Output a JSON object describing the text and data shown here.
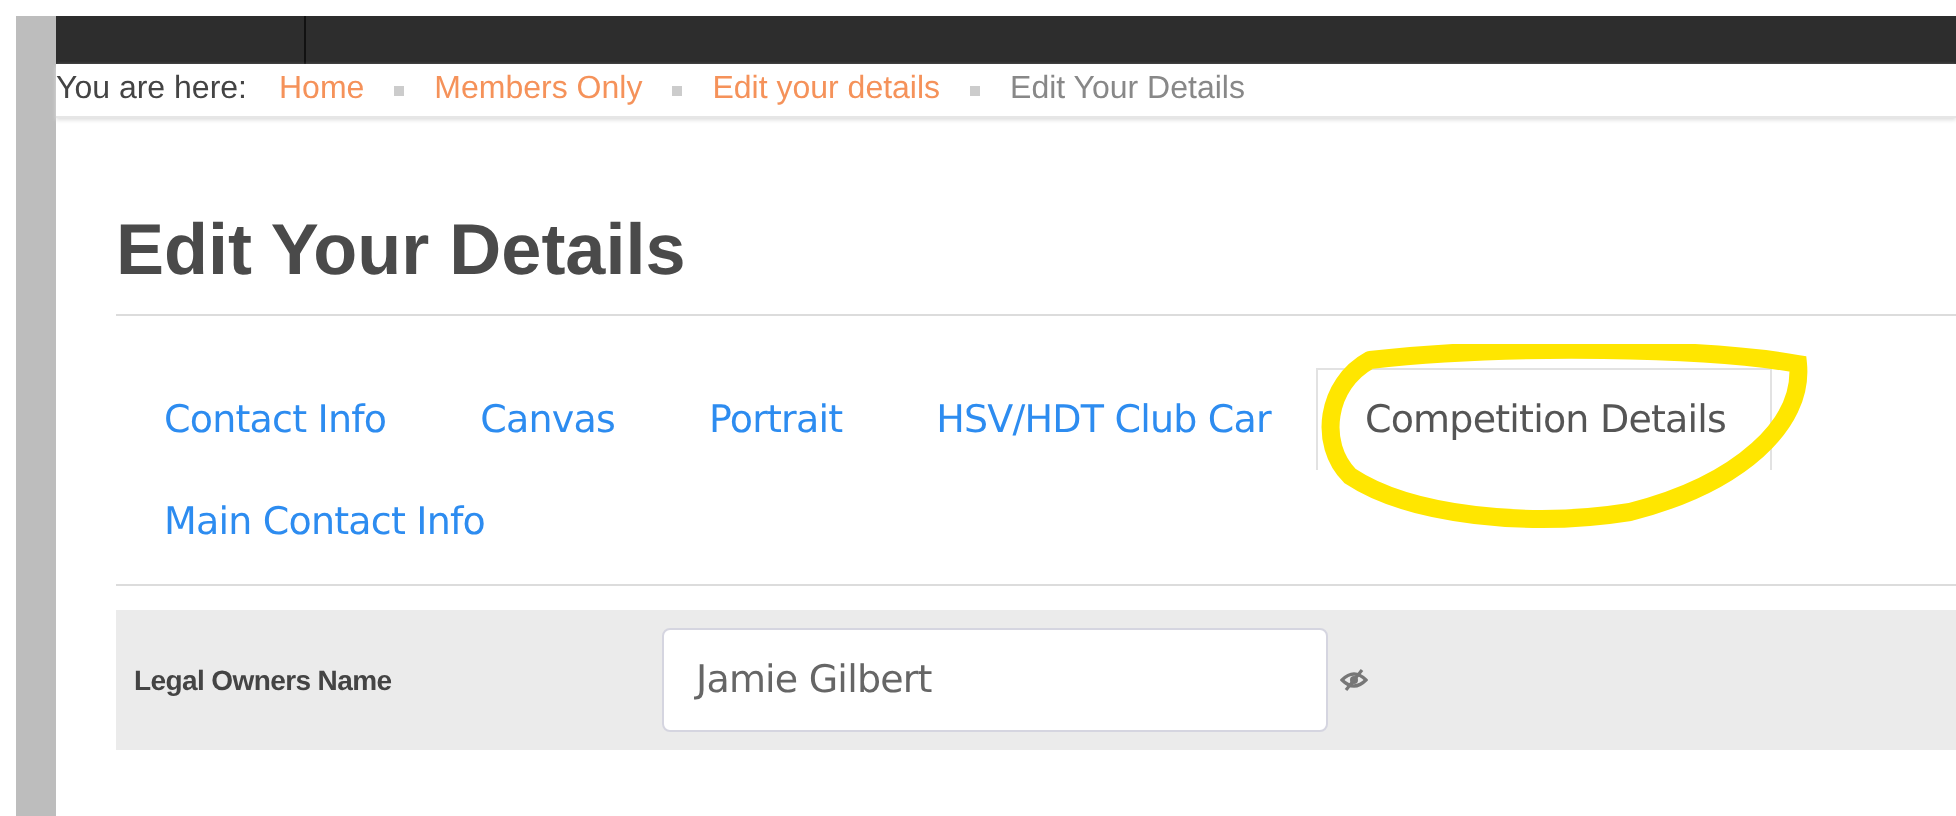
{
  "breadcrumb": {
    "label": "You are here:",
    "items": [
      {
        "text": "Home",
        "kind": "link"
      },
      {
        "text": "Members Only",
        "kind": "link"
      },
      {
        "text": "Edit your details",
        "kind": "link"
      },
      {
        "text": "Edit Your Details",
        "kind": "current"
      }
    ]
  },
  "heading": "Edit Your Details",
  "tabs": [
    {
      "label": "Contact Info",
      "selected": false
    },
    {
      "label": "Canvas",
      "selected": false
    },
    {
      "label": "Portrait",
      "selected": false
    },
    {
      "label": "HSV/HDT Club Car",
      "selected": false
    },
    {
      "label": "Competition Details",
      "selected": true
    },
    {
      "label": "Main Contact Info",
      "selected": false
    }
  ],
  "fields": [
    {
      "label": "Legal Owners Name",
      "value": "Jamie Gilbert",
      "hidden": true
    }
  ]
}
